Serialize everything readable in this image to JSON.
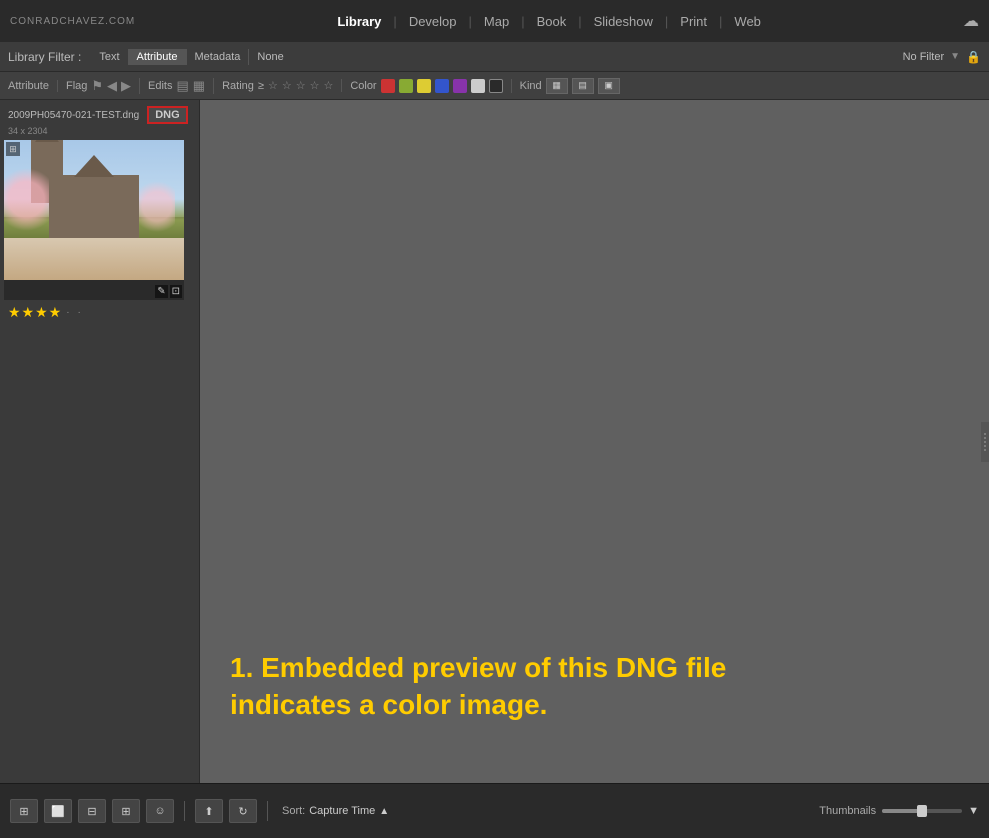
{
  "brand": "CONRADCHAVEZ.COM",
  "nav": {
    "items": [
      {
        "label": "Library",
        "active": true
      },
      {
        "label": "Develop",
        "active": false
      },
      {
        "label": "Map",
        "active": false
      },
      {
        "label": "Book",
        "active": false
      },
      {
        "label": "Slideshow",
        "active": false
      },
      {
        "label": "Print",
        "active": false
      },
      {
        "label": "Web",
        "active": false
      }
    ]
  },
  "filter_bar": {
    "label": "Library Filter :",
    "tabs": [
      {
        "label": "Text",
        "active": false
      },
      {
        "label": "Attribute",
        "active": true
      },
      {
        "label": "Metadata",
        "active": false
      },
      {
        "label": "None",
        "active": false
      }
    ],
    "no_filter": "No Filter",
    "lock": "🔒"
  },
  "attribute_bar": {
    "attribute_label": "Attribute",
    "flag_label": "Flag",
    "edits_label": "Edits",
    "rating_label": "Rating",
    "color_label": "Color",
    "kind_label": "Kind",
    "colors": [
      "#cc3333",
      "#88aa33",
      "#ddcc33",
      "#3355cc",
      "#8833aa",
      "#cccccc",
      "#2a2a2a"
    ],
    "rating_symbol": "≥"
  },
  "file": {
    "name": "2009PH05470-021-TEST.dng",
    "size": "34",
    "badge": "DNG",
    "dimensions": "x 2304"
  },
  "thumbnail": {
    "stars": "★★★★",
    "partial_star": "·",
    "color_label": " ·"
  },
  "annotation": {
    "line1": "1. Embedded preview of this DNG file",
    "line2": "indicates a color image."
  },
  "bottom_toolbar": {
    "sort_label": "Sort:",
    "sort_value": "Capture Time",
    "sort_arrow": "▲",
    "thumbnails_label": "Thumbnails"
  }
}
